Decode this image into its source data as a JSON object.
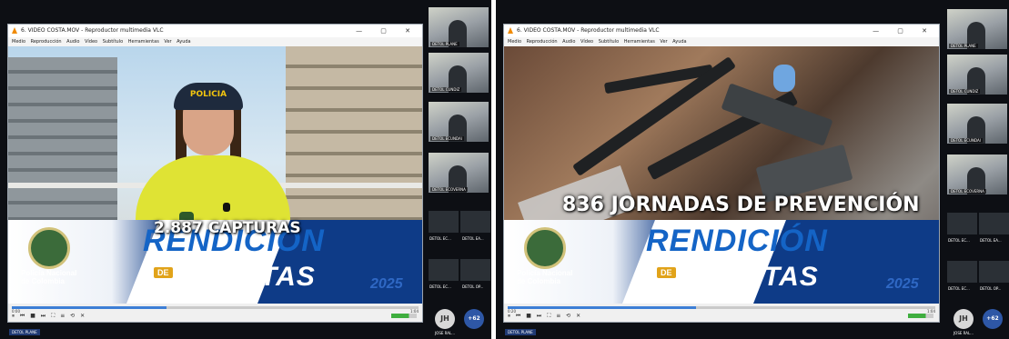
{
  "left": {
    "window_title": "6. VIDEO COSTA.MOV - Reproductor multimedia VLC",
    "menu": [
      "Medio",
      "Reproducción",
      "Audio",
      "Vídeo",
      "Subtítulo",
      "Herramientas",
      "Ver",
      "Ayuda"
    ],
    "window_controls": "—  ▢  ✕",
    "cap_text": "POLICIA",
    "caption": "2.887 CAPTURAS",
    "banner": {
      "rendicion": "RENDICIÓN",
      "de": "DE",
      "cuentas": "CUENTAS",
      "year": "2025",
      "org_line1": "Policía Nacional",
      "org_line2": "de Colombia"
    },
    "time_left": "0:00",
    "time_right": "1:04",
    "controls": "⏸ ⏮ ■ ⏭  ⛶ ≡ ⟲ ✕",
    "participants": [
      {
        "label": "DETOL PLANE"
      },
      {
        "label": "DETOL CUNDIZ"
      },
      {
        "label": "DETOL ECUNDAI"
      },
      {
        "label": "DETOL ECOVERNA"
      }
    ],
    "mini_tiles": [
      {
        "label": "DETOL EC..."
      },
      {
        "label": "DETOL EA..."
      },
      {
        "label": "DETOL EC..."
      },
      {
        "label": "DETOL OP..."
      }
    ],
    "avatar_initials": "JH",
    "avatar_label": "JOSE RAL...",
    "more_count": "+62",
    "bottom_tag": "DETOL PLANE"
  },
  "right": {
    "window_title": "6. VIDEO COSTA.MOV - Reproductor multimedia VLC",
    "menu": [
      "Medio",
      "Reproducción",
      "Audio",
      "Vídeo",
      "Subtítulo",
      "Herramientas",
      "Ver",
      "Ayuda"
    ],
    "window_controls": "—  ▢  ✕",
    "caption": "836 JORNADAS DE PREVENCIÓN",
    "banner": {
      "rendicion": "RENDICIÓN",
      "de": "DE",
      "cuentas": "CUENTAS",
      "year": "2025",
      "org_line1": "Policía Nacional",
      "org_line2": "de Colombia"
    },
    "time_left": "0:20",
    "time_right": "1:04",
    "controls": "⏸ ⏮ ■ ⏭  ⛶ ≡ ⟲ ✕",
    "participants": [
      {
        "label": "DETOL PLANE"
      },
      {
        "label": "DETOL CUNDIZ"
      },
      {
        "label": "DETOL ECUNDAI"
      },
      {
        "label": "DETOL ECOVERNA"
      }
    ],
    "mini_tiles": [
      {
        "label": "DETOL EC..."
      },
      {
        "label": "DETOL EA..."
      },
      {
        "label": "DETOL EC..."
      },
      {
        "label": "DETOL OP..."
      }
    ],
    "avatar_initials": "JH",
    "avatar_label": "JOSE RAL...",
    "more_count": "+62",
    "bottom_tag": "DETOL PLANE"
  },
  "colors": {
    "accent_blue": "#1464c6",
    "banner_navy": "#0e3b87",
    "caption_white": "#ffffff",
    "police_yellow": "#dfe334"
  }
}
